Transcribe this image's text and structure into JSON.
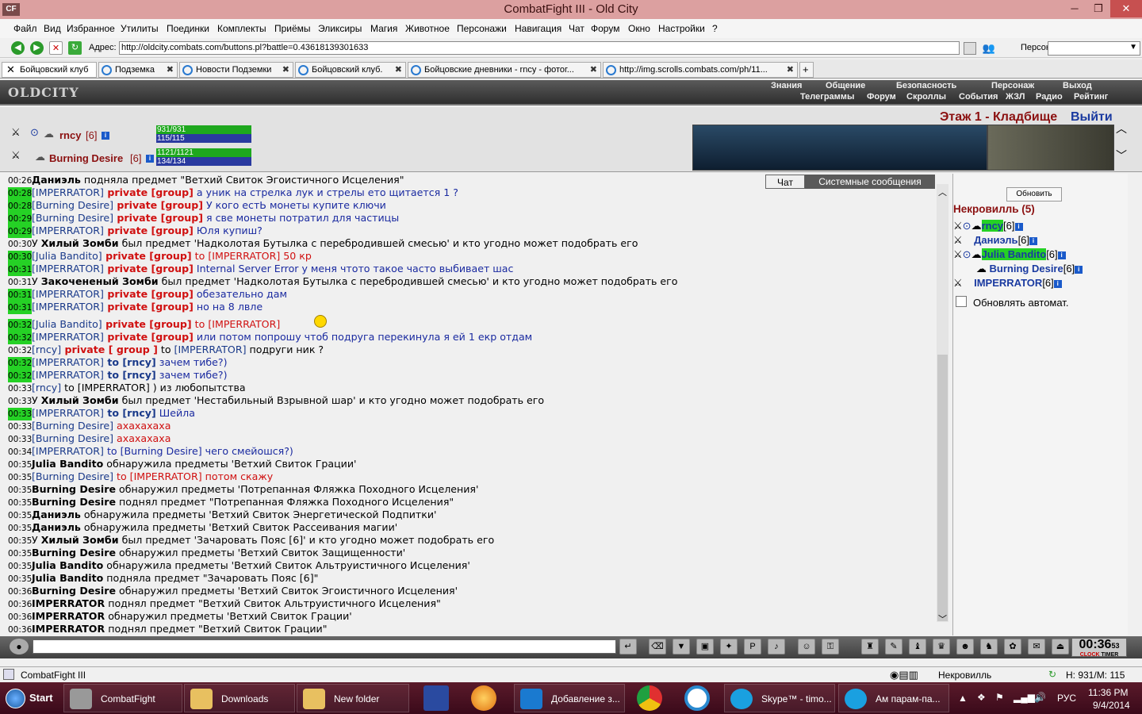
{
  "window": {
    "title": "CombatFight III - Old City",
    "app_icon": "CF"
  },
  "menu": [
    "Файл",
    "Вид",
    "Избранное",
    "Утилиты",
    "Поединки",
    "Комплекты",
    "Приёмы",
    "Эликсиры",
    "Магия",
    "Животное",
    "Персонажи",
    "Навигация",
    "Чат",
    "Форум",
    "Окно",
    "Настройки",
    "?"
  ],
  "address": {
    "label": "Адрес:",
    "value": "http://oldcity.combats.com/buttons.pl?battle=0.43618139301633",
    "persona_label": "Персонаж:"
  },
  "tabs": [
    {
      "label": "Бойцовский клуб"
    },
    {
      "label": "Подземка"
    },
    {
      "label": "Новости Подземки"
    },
    {
      "label": "Бойцовский клуб."
    },
    {
      "label": "Бойцовские дневники - rncy - фотог..."
    },
    {
      "label": "http://img.scrolls.combats.com/ph/11..."
    }
  ],
  "header": {
    "logo": "OLDCITY",
    "nav_top": [
      "Знания",
      "Общение",
      "Безопасность",
      "Персонаж",
      "Выход"
    ],
    "nav_bottom": [
      "Телеграммы",
      "Форум",
      "Скроллы",
      "События",
      "ЖЗЛ",
      "Радио",
      "Рейтинг"
    ]
  },
  "players": [
    {
      "name": "rncy",
      "level": "[6]",
      "hp": "931/931",
      "mana": "115/115"
    },
    {
      "name": "Burning Desire",
      "level": "[6]",
      "hp": "1121/1121",
      "mana": "134/134"
    }
  ],
  "location": {
    "name": "Этаж 1 - Кладбище",
    "exit": "Выйти"
  },
  "chat_tabs": [
    "Чат",
    "Системные сообщения"
  ],
  "chat": [
    {
      "t": "00:26",
      "g": false,
      "parts": [
        [
          "b",
          "Даниэль"
        ],
        [
          "k",
          " подняла предмет \"Ветхий Свиток Эгоистичного Исцеления\""
        ]
      ]
    },
    {
      "t": "00:28",
      "g": true,
      "parts": [
        [
          "n",
          "[IMPERRATOR]"
        ],
        [
          "p",
          " private [group]"
        ],
        [
          "x",
          " а уник на стрелка лук и стрелы ето щитается 1 ?"
        ]
      ]
    },
    {
      "t": "00:28",
      "g": true,
      "parts": [
        [
          "n",
          "[Burning Desire]"
        ],
        [
          "p",
          " private [group]"
        ],
        [
          "x",
          " У кого естЬ монеты купите ключи"
        ]
      ]
    },
    {
      "t": "00:29",
      "g": true,
      "parts": [
        [
          "n",
          "[Burning Desire]"
        ],
        [
          "p",
          " private [group]"
        ],
        [
          "x",
          " я све монеты потратил для частицы"
        ]
      ]
    },
    {
      "t": "00:29",
      "g": true,
      "parts": [
        [
          "n",
          "[IMPERRATOR]"
        ],
        [
          "p",
          " private [group]"
        ],
        [
          "x",
          " Юля купиш?"
        ]
      ]
    },
    {
      "t": "00:30",
      "g": false,
      "parts": [
        [
          "k",
          "У "
        ],
        [
          "b",
          "Хилый Зомби"
        ],
        [
          "k",
          " был предмет 'Надколотая Бутылка с перебродившей смесью' и кто угодно может подобрать его"
        ]
      ]
    },
    {
      "t": "00:30",
      "g": true,
      "parts": [
        [
          "n",
          "[Julia Bandito]"
        ],
        [
          "p",
          " private [group]"
        ],
        [
          "o",
          " to [IMPERRATOR] 50 кр"
        ]
      ]
    },
    {
      "t": "00:31",
      "g": true,
      "parts": [
        [
          "n",
          "[IMPERRATOR]"
        ],
        [
          "p",
          " private [group]"
        ],
        [
          "x",
          " Internal Server Error у меня чтото такое часто выбивает шас"
        ]
      ]
    },
    {
      "t": "00:31",
      "g": false,
      "parts": [
        [
          "k",
          "У "
        ],
        [
          "b",
          "Закочененый Зомби"
        ],
        [
          "k",
          " был предмет 'Надколотая Бутылка с перебродившей смесью' и кто угодно может подобрать его"
        ]
      ]
    },
    {
      "t": "00:31",
      "g": true,
      "parts": [
        [
          "n",
          "[IMPERRATOR]"
        ],
        [
          "p",
          " private [group]"
        ],
        [
          "x",
          " обезательно дам"
        ]
      ]
    },
    {
      "t": "00:31",
      "g": true,
      "parts": [
        [
          "n",
          "[IMPERRATOR]"
        ],
        [
          "p",
          " private [group]"
        ],
        [
          "x",
          " но на 8 лвле"
        ]
      ]
    },
    {
      "t": "00:32",
      "g": true,
      "parts": [
        [
          "n",
          "[Julia Bandito]"
        ],
        [
          "p",
          " private [group]"
        ],
        [
          "o",
          " to [IMPERRATOR]"
        ]
      ]
    },
    {
      "t": "00:32",
      "g": true,
      "parts": [
        [
          "n",
          "[IMPERRATOR]"
        ],
        [
          "p",
          " private [group]"
        ],
        [
          "x",
          " или потом попрошу чтоб подруга перекинула я ей 1 екр отдам"
        ]
      ]
    },
    {
      "t": "00:32",
      "g": false,
      "parts": [
        [
          "n",
          "[rncy]"
        ],
        [
          "p",
          " private [ group ]"
        ],
        [
          "k",
          " to "
        ],
        [
          "n",
          "[IMPERRATOR]"
        ],
        [
          "k",
          " подруги ник ?"
        ]
      ]
    },
    {
      "t": "00:32",
      "g": true,
      "parts": [
        [
          "n",
          "[IMPERRATOR]"
        ],
        [
          "nb",
          " to [rncy]"
        ],
        [
          "x",
          " зачем тибе?)"
        ]
      ]
    },
    {
      "t": "00:32",
      "g": true,
      "parts": [
        [
          "n",
          "[IMPERRATOR]"
        ],
        [
          "nb",
          " to [rncy]"
        ],
        [
          "x",
          " зачем тибе?)"
        ]
      ]
    },
    {
      "t": "00:33",
      "g": false,
      "parts": [
        [
          "n",
          "[rncy]"
        ],
        [
          "k",
          " to [IMPERRATOR] ) из любопытства"
        ]
      ]
    },
    {
      "t": "00:33",
      "g": false,
      "parts": [
        [
          "k",
          "У "
        ],
        [
          "b",
          "Хилый Зомби"
        ],
        [
          "k",
          " был предмет 'Нестабильный Взрывной шар' и кто угодно может подобрать его"
        ]
      ]
    },
    {
      "t": "00:33",
      "g": true,
      "parts": [
        [
          "n",
          "[IMPERRATOR]"
        ],
        [
          "nb",
          " to [rncy]"
        ],
        [
          "x",
          " Шейла"
        ]
      ]
    },
    {
      "t": "00:33",
      "g": false,
      "parts": [
        [
          "n",
          "[Burning Desire]"
        ],
        [
          "o",
          " ахахахаха"
        ]
      ]
    },
    {
      "t": "00:33",
      "g": false,
      "parts": [
        [
          "n",
          "[Burning Desire]"
        ],
        [
          "o",
          " ахахахаха"
        ]
      ]
    },
    {
      "t": "00:34",
      "g": false,
      "parts": [
        [
          "n",
          "[IMPERRATOR]"
        ],
        [
          "x",
          " to [Burning Desire] чего смейошся?)"
        ]
      ]
    },
    {
      "t": "00:35",
      "g": false,
      "parts": [
        [
          "b",
          "Julia Bandito"
        ],
        [
          "k",
          " обнаружила предметы 'Ветхий Свиток Грации'"
        ]
      ]
    },
    {
      "t": "00:35",
      "g": false,
      "parts": [
        [
          "n",
          "[Burning Desire]"
        ],
        [
          "o",
          " to [IMPERRATOR] потом скажу"
        ]
      ]
    },
    {
      "t": "00:35",
      "g": false,
      "parts": [
        [
          "b",
          "Burning Desire"
        ],
        [
          "k",
          " обнаружил предметы 'Потрепанная Фляжка Походного Исцеления'"
        ]
      ]
    },
    {
      "t": "00:35",
      "g": false,
      "parts": [
        [
          "b",
          "Burning Desire"
        ],
        [
          "k",
          " поднял предмет \"Потрепанная Фляжка Походного Исцеления\""
        ]
      ]
    },
    {
      "t": "00:35",
      "g": false,
      "parts": [
        [
          "b",
          "Даниэль"
        ],
        [
          "k",
          " обнаружила предметы 'Ветхий Свиток Энергетической Подпитки'"
        ]
      ]
    },
    {
      "t": "00:35",
      "g": false,
      "parts": [
        [
          "b",
          "Даниэль"
        ],
        [
          "k",
          " обнаружила предметы 'Ветхий Свиток Рассеивания магии'"
        ]
      ]
    },
    {
      "t": "00:35",
      "g": false,
      "parts": [
        [
          "k",
          "У "
        ],
        [
          "b",
          "Хилый Зомби"
        ],
        [
          "k",
          " был предмет 'Зачаровать Пояс [6]' и кто угодно может подобрать его"
        ]
      ]
    },
    {
      "t": "00:35",
      "g": false,
      "parts": [
        [
          "b",
          "Burning Desire"
        ],
        [
          "k",
          " обнаружил предметы 'Ветхий Свиток Защищенности'"
        ]
      ]
    },
    {
      "t": "00:35",
      "g": false,
      "parts": [
        [
          "b",
          "Julia Bandito"
        ],
        [
          "k",
          " обнаружила предметы 'Ветхий Свиток Альтруистичного Исцеления'"
        ]
      ]
    },
    {
      "t": "00:35",
      "g": false,
      "parts": [
        [
          "b",
          "Julia Bandito"
        ],
        [
          "k",
          " подняла предмет \"Зачаровать Пояс [6]\""
        ]
      ]
    },
    {
      "t": "00:36",
      "g": false,
      "parts": [
        [
          "b",
          "Burning Desire"
        ],
        [
          "k",
          " обнаружил предметы 'Ветхий Свиток Эгоистичного Исцеления'"
        ]
      ]
    },
    {
      "t": "00:36",
      "g": false,
      "parts": [
        [
          "b",
          "IMPERRATOR"
        ],
        [
          "k",
          " поднял предмет \"Ветхий Свиток Альтруистичного Исцеления\""
        ]
      ]
    },
    {
      "t": "00:36",
      "g": false,
      "parts": [
        [
          "b",
          "IMPERRATOR"
        ],
        [
          "k",
          " обнаружил предметы 'Ветхий Свиток Грации'"
        ]
      ]
    },
    {
      "t": "00:36",
      "g": false,
      "parts": [
        [
          "b",
          "IMPERRATOR"
        ],
        [
          "k",
          " поднял предмет \"Ветхий Свиток Грации\""
        ]
      ]
    }
  ],
  "room": {
    "refresh": "Обновить",
    "name": "Некровилль (5)",
    "players": [
      {
        "name": "rncy",
        "level": "[6]",
        "highlight": true
      },
      {
        "name": "Даниэль",
        "level": "[6]",
        "highlight": false
      },
      {
        "name": "Julia Bandito",
        "level": "[6]",
        "highlight": true
      },
      {
        "name": "Burning Desire",
        "level": "[6]",
        "highlight": false
      },
      {
        "name": "IMPERRATOR",
        "level": "[6]",
        "highlight": false
      }
    ],
    "auto_refresh": "Обновлять автомат."
  },
  "clock": {
    "time": "00:36",
    "seconds": "53",
    "clock_label": "CLOCK",
    "timer_label": "TIMER"
  },
  "status": {
    "app": "CombatFight III",
    "room": "Некровилль",
    "hm": "H: 931/M: 115"
  },
  "taskbar": {
    "start": "Start",
    "items": [
      "CombatFight",
      "Downloads",
      "New folder",
      "Добавление з...",
      "Skype™ - timo...",
      "Ам парам-па..."
    ],
    "lang": "РУС",
    "time": "11:36 PM",
    "date": "9/4/2014"
  },
  "colors": {
    "title_bg": "#dca0a0",
    "name": "#1a3a8a",
    "private": "#d01010",
    "time_green": "#25d125",
    "location": "#8b1010",
    "taskbar": "#4a1020"
  }
}
